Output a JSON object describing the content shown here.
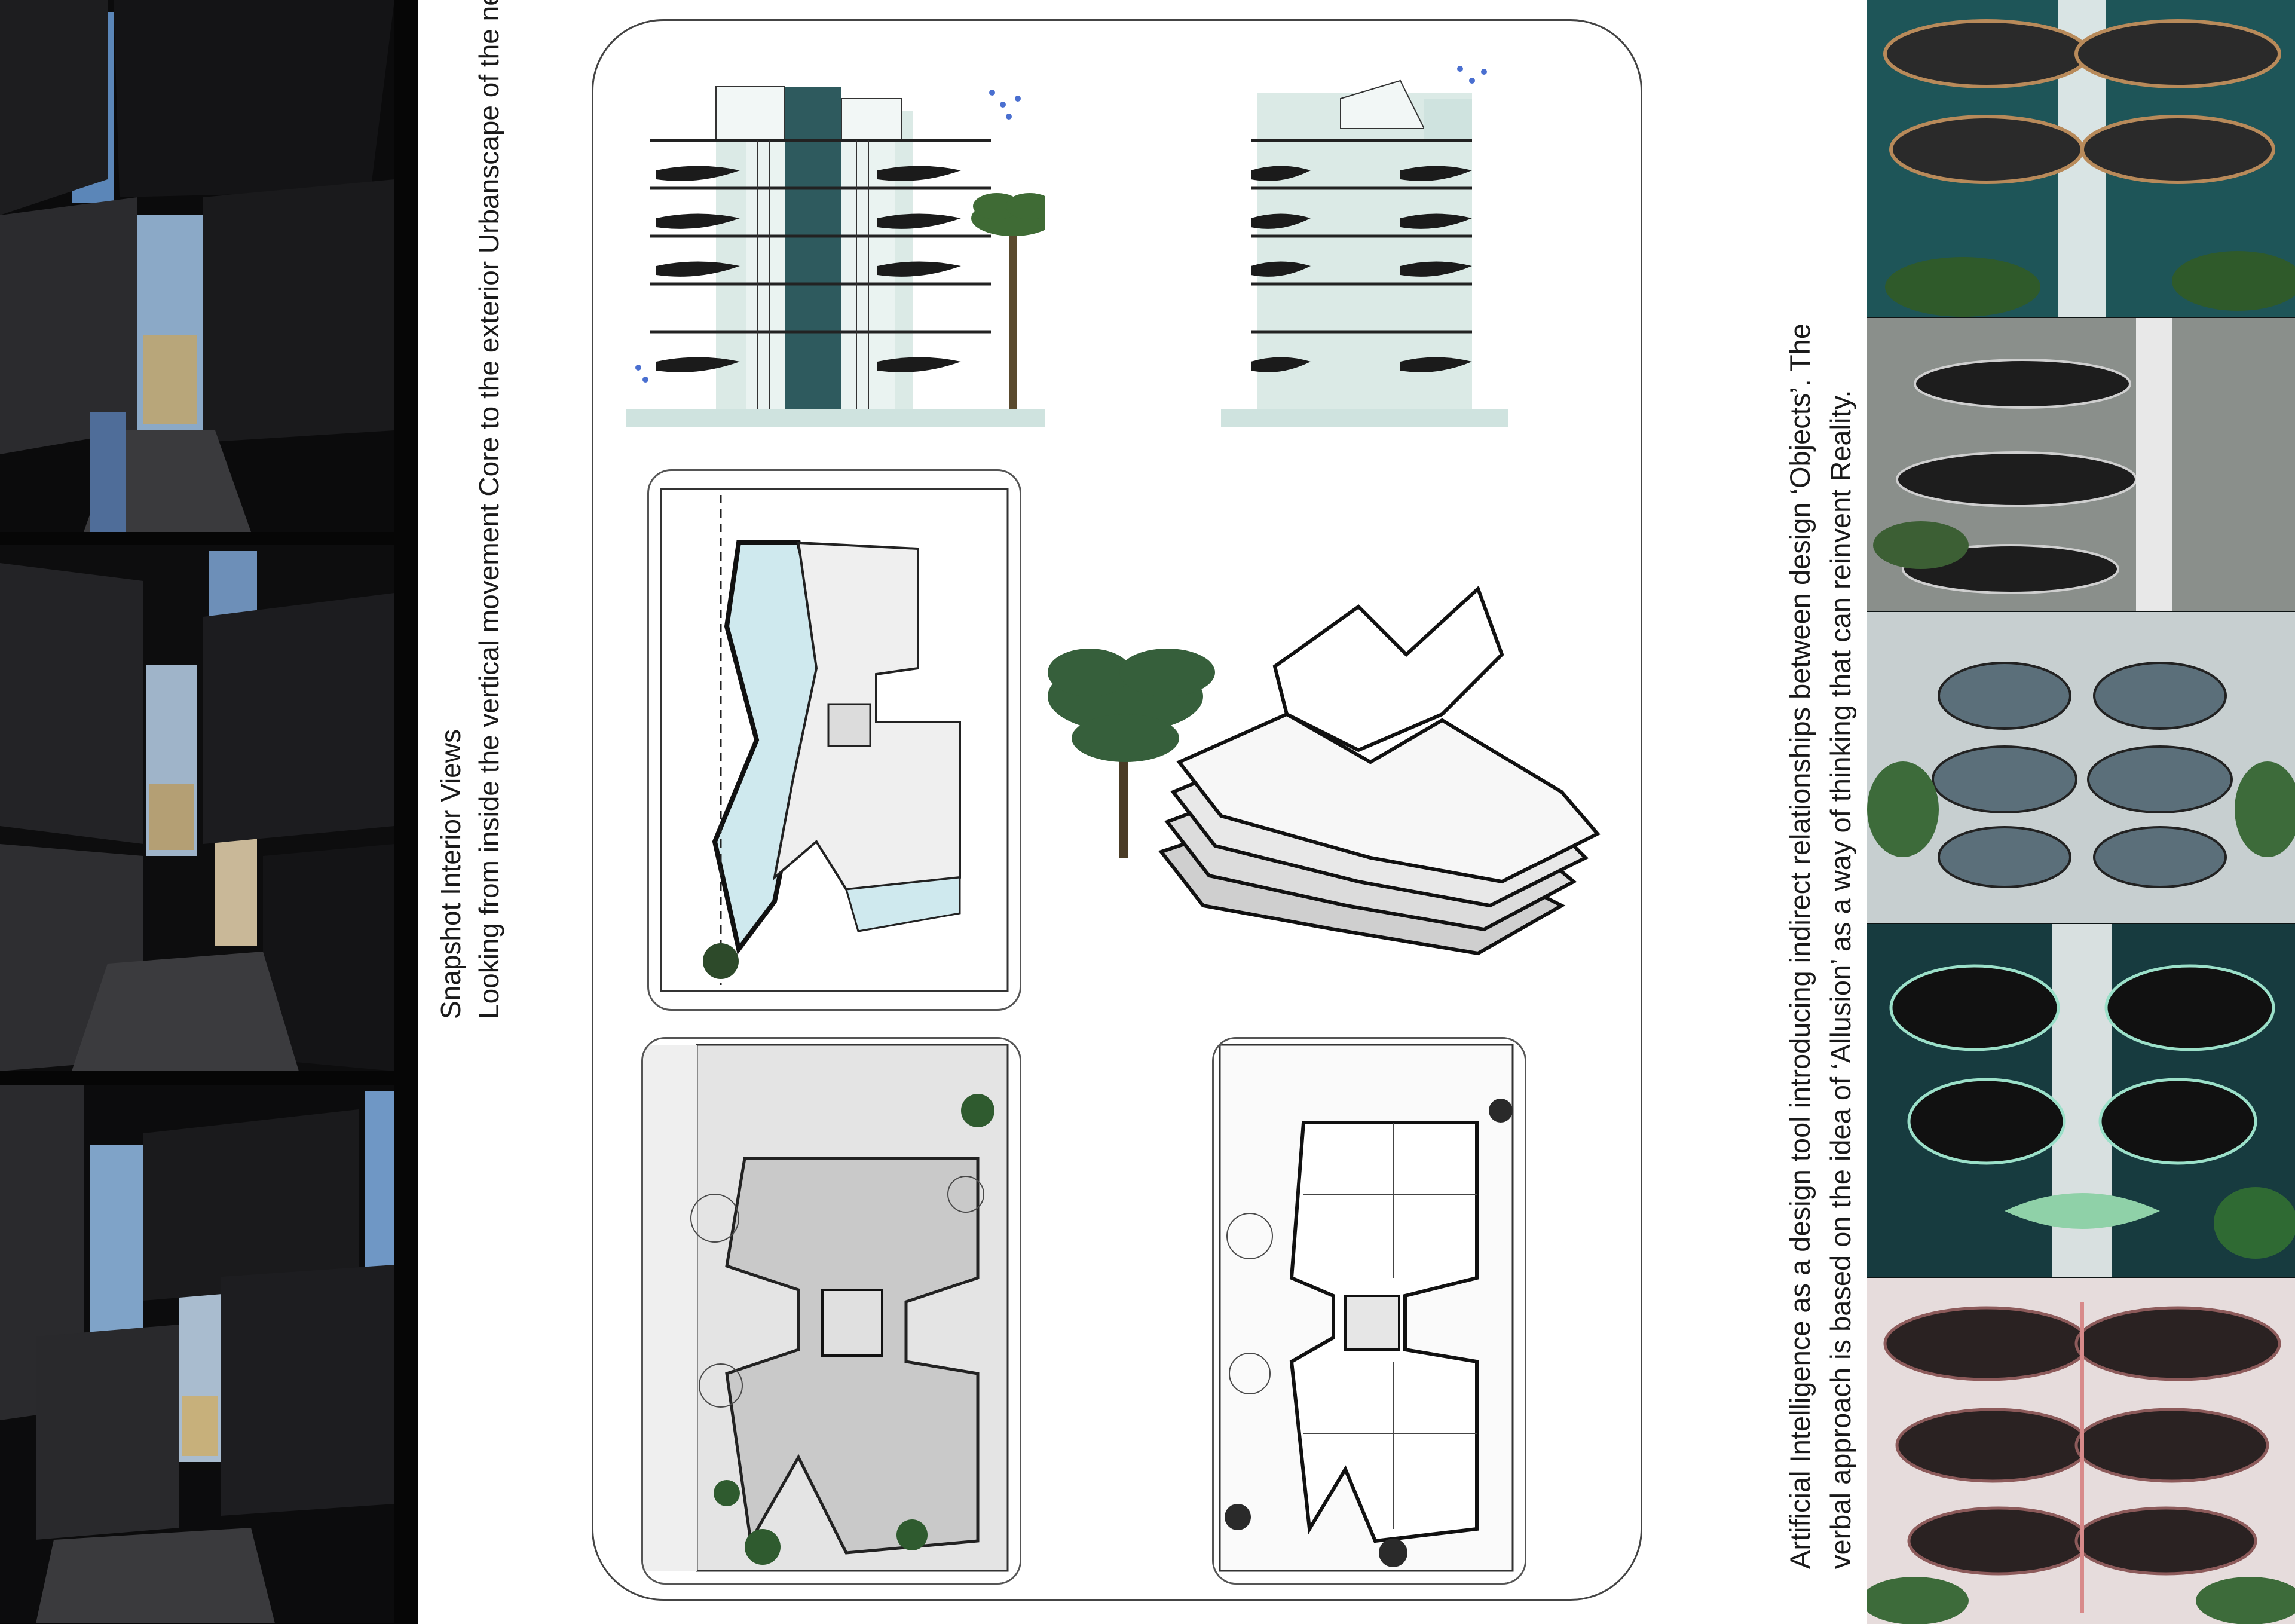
{
  "interior_caption": {
    "title": "Snapshot Interior Views",
    "subtitle": "Looking  from inside the vertical movement Core to the exterior Urbanscape of the neighborhood"
  },
  "ai_caption": {
    "line1": "Artificial Intelligence as a design tool introducing indirect relationships between design ‘Objects’. The",
    "line2": "verbal approach is based on the idea of ‘Allusion’ as a way of thinking that can reinvent Reality."
  },
  "colors": {
    "accent_mint": "#cfe3df",
    "pool_blue": "#cfe9ee",
    "plan_gray": "#c9c9c9",
    "ink": "#1a1a1a"
  },
  "images": {
    "interior_photos": [
      "interior-photo-1",
      "interior-photo-2",
      "interior-photo-3"
    ],
    "ai_renders": [
      "ai-render-1",
      "ai-render-2",
      "ai-render-3",
      "ai-render-4",
      "ai-render-5"
    ]
  }
}
